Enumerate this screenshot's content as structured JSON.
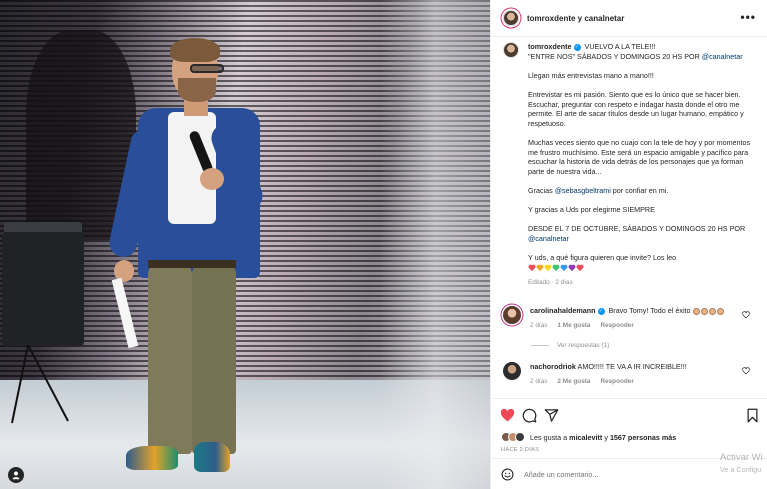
{
  "post": {
    "header_user": "tomroxdente y canalnetar",
    "more": "•••"
  },
  "caption": {
    "user": "tomroxdente",
    "first_line": "VUELVO A LA TELE!!!",
    "second_line_pre": "\"ENTRE NOS\" SÁBADOS Y DOMINGOS 20 HS POR ",
    "mention_canal": "@canalnetar",
    "p1": "Llegan más entrevistas mano a mano!!!",
    "p2": "Entrevistar es mi pasión. Siento que es lo único que se hacer bien. Escuchar, preguntar con respeto e indagar hasta donde el otro me permite. El arte de sacar títulos desde un lugar humano, empático y respetuoso.",
    "p3": "Muchas veces siento que no cuajo con la tele de hoy y por momentos me frustro muchísimo. Este será un espacio amigable y pacífico para escuchar la historia de vida detrás de los personajes que ya forman parte de nuestra vida...",
    "p4_pre": "Gracias ",
    "p4_mention": "@sebasgbeltrami",
    "p4_post": " por confiar en mi.",
    "p5": "Y gracias a Uds por elegirme SIEMPRE",
    "p6_pre": "DESDE EL 7 DE OCTUBRE, SÁBADOS Y DOMINGOS 20 HS POR ",
    "p6_mention": "@canalnetar",
    "p7": "Y uds, a qué figura quieren que invite? Los leo",
    "hearts": [
      "#ed4956",
      "#f5a623",
      "#f8d81c",
      "#3ec46d",
      "#3897f0",
      "#8a3ab9",
      "#ed4956"
    ],
    "edited": "Editado · 2 días"
  },
  "comments": [
    {
      "user": "carolinahaldemann",
      "text": "Bravo Tomy! Todo el éxito",
      "time": "2 días",
      "likes": "1 Me gusta",
      "reply": "Responder",
      "view_replies": "Ver respuestas (1)"
    },
    {
      "user": "nachorodriok",
      "text": "AMO!!!!! TE VA A IR INCREIBLE!!!",
      "time": "2 días",
      "likes": "2 Me gusta",
      "reply": "Responder"
    }
  ],
  "likes": {
    "pre": "Les gusta a ",
    "user": "micalevitt",
    "mid": " y ",
    "count": "1567 personas más"
  },
  "time_ago": "HACE 2 DÍAS",
  "add_comment": {
    "placeholder": "Añade un comentario..."
  },
  "watermark": {
    "line1": "Activar Wi",
    "line2": "Ve a Configu"
  }
}
